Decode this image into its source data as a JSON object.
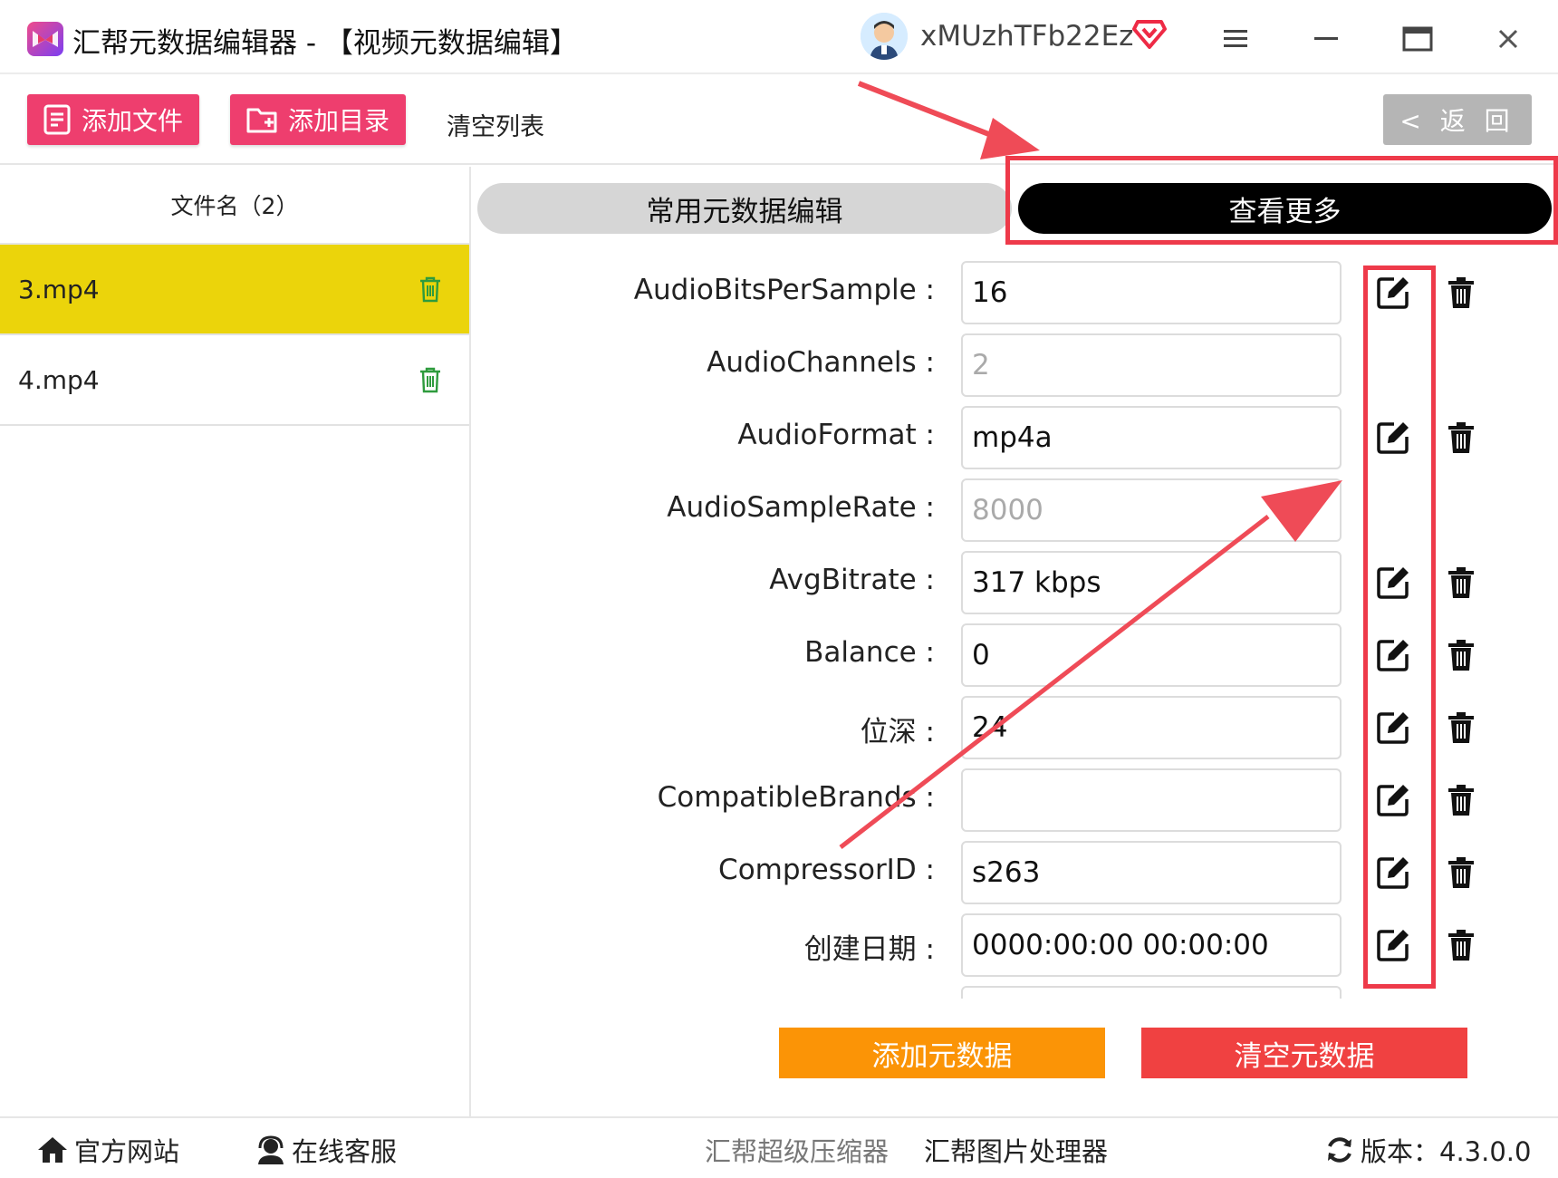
{
  "titlebar": {
    "title": "汇帮元数据编辑器 - 【视频元数据编辑】",
    "username": "xMUzhTFb22Ez"
  },
  "toolbar": {
    "add_file": "添加文件",
    "add_dir": "添加目录",
    "clear_list": "清空列表",
    "back": "< 返 回"
  },
  "file_list": {
    "header": "文件名（2）",
    "files": [
      {
        "name": "3.mp4",
        "active": true
      },
      {
        "name": "4.mp4",
        "active": false
      }
    ]
  },
  "tabs": {
    "common": "常用元数据编辑",
    "more": "查看更多"
  },
  "metadata": [
    {
      "label": "AudioBitsPerSample :",
      "value": "16",
      "editable": true
    },
    {
      "label": "AudioChannels :",
      "value": "2",
      "editable": false
    },
    {
      "label": "AudioFormat :",
      "value": "mp4a",
      "editable": true
    },
    {
      "label": "AudioSampleRate :",
      "value": "8000",
      "editable": false
    },
    {
      "label": "AvgBitrate :",
      "value": "317 kbps",
      "editable": true
    },
    {
      "label": "Balance :",
      "value": "0",
      "editable": true
    },
    {
      "label": "位深 :",
      "value": "24",
      "editable": true
    },
    {
      "label": "CompatibleBrands :",
      "value": "",
      "editable": true
    },
    {
      "label": "CompressorID :",
      "value": "s263",
      "editable": true
    },
    {
      "label": "创建日期 :",
      "value": "0000:00:00 00:00:00",
      "editable": true
    }
  ],
  "actions": {
    "add_meta": "添加元数据",
    "clear_meta": "清空元数据"
  },
  "footer": {
    "website": "官方网站",
    "support": "在线客服",
    "compressor": "汇帮超级压缩器",
    "image_tool": "汇帮图片处理器",
    "version": "版本：4.3.0.0"
  },
  "colors": {
    "accent_pink": "#ee3e6e",
    "active_file": "#ebd40b",
    "annotation_red": "#ee3a4a",
    "orange": "#fb9406",
    "red": "#f04141"
  }
}
